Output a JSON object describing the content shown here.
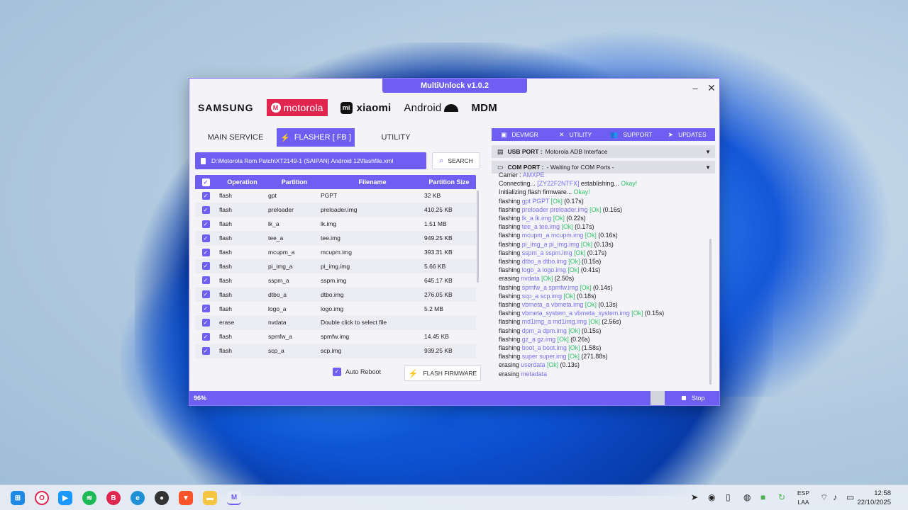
{
  "window": {
    "title": "MultiUnlock v1.0.2",
    "minimize": "–",
    "close": "✕"
  },
  "brands": [
    "SAMSUNG",
    "motorola",
    "xiaomi",
    "Android",
    "MDM"
  ],
  "left_tabs": [
    "MAIN SERVICE",
    "FLASHER [ FB ]",
    "UTILITY"
  ],
  "active_left_tab": "FLASHER [ FB ]",
  "flash_file_path": "D:\\Motorola Rom Patch\\XT2149-1 (SAIPAN) Android 12\\flashfile.xml",
  "search_label": "SEARCH",
  "table": {
    "headers": [
      "Operation",
      "Partition",
      "Filename",
      "Partition Size"
    ],
    "rows": [
      {
        "op": "flash",
        "partition": "gpt",
        "filename": "PGPT",
        "size": "32 KB"
      },
      {
        "op": "flash",
        "partition": "preloader",
        "filename": "preloader.img",
        "size": "410.25 KB"
      },
      {
        "op": "flash",
        "partition": "lk_a",
        "filename": "lk.img",
        "size": "1.51 MB"
      },
      {
        "op": "flash",
        "partition": "tee_a",
        "filename": "tee.img",
        "size": "949.25 KB"
      },
      {
        "op": "flash",
        "partition": "mcupm_a",
        "filename": "mcupm.img",
        "size": "393.31 KB"
      },
      {
        "op": "flash",
        "partition": "pi_img_a",
        "filename": "pi_img.img",
        "size": "5.66 KB"
      },
      {
        "op": "flash",
        "partition": "sspm_a",
        "filename": "sspm.img",
        "size": "645.17 KB"
      },
      {
        "op": "flash",
        "partition": "dtbo_a",
        "filename": "dtbo.img",
        "size": "276.05 KB"
      },
      {
        "op": "flash",
        "partition": "logo_a",
        "filename": "logo.img",
        "size": "5.2 MB"
      },
      {
        "op": "erase",
        "partition": "nvdata",
        "filename": "Double click to select file",
        "size": ""
      },
      {
        "op": "flash",
        "partition": "spmfw_a",
        "filename": "spmfw.img",
        "size": "14.45 KB"
      },
      {
        "op": "flash",
        "partition": "scp_a",
        "filename": "scp.img",
        "size": "939.25 KB"
      }
    ]
  },
  "auto_reboot_label": "Auto Reboot",
  "flash_firmware_label": "FLASH FIRMWARE",
  "right_tabs": [
    "DEVMGR",
    "UTILITY",
    "SUPPORT",
    "UPDATES"
  ],
  "usb_port": {
    "label": "USB PORT :",
    "value": "Motorola ADB Interface"
  },
  "com_port": {
    "label": "COM PORT :",
    "value": "- Waiting for COM Ports -"
  },
  "log": [
    [
      [
        "Carrier : ",
        "n"
      ],
      [
        "AMXPE",
        "p"
      ]
    ],
    [
      [
        "Connecting... ",
        "n"
      ],
      [
        "[ZY22F2NTFX]",
        "p"
      ],
      [
        " establishing... ",
        "n"
      ],
      [
        "Okay!",
        "g"
      ]
    ],
    [
      [
        "Initializing flash firmware... ",
        "n"
      ],
      [
        "Okay!",
        "g"
      ]
    ],
    [
      [
        "flashing ",
        "n"
      ],
      [
        "gpt PGPT",
        "p"
      ],
      [
        " [Ok]",
        "g"
      ],
      [
        " (0.17s)",
        "n"
      ]
    ],
    [
      [
        "flashing ",
        "n"
      ],
      [
        "preloader preloader.img",
        "p"
      ],
      [
        " [Ok]",
        "g"
      ],
      [
        " (0.16s)",
        "n"
      ]
    ],
    [
      [
        "flashing ",
        "n"
      ],
      [
        "lk_a lk.img",
        "p"
      ],
      [
        " [Ok]",
        "g"
      ],
      [
        " (0.22s)",
        "n"
      ]
    ],
    [
      [
        "flashing ",
        "n"
      ],
      [
        "tee_a tee.img",
        "p"
      ],
      [
        " [Ok]",
        "g"
      ],
      [
        " (0.17s)",
        "n"
      ]
    ],
    [
      [
        "flashing ",
        "n"
      ],
      [
        "mcupm_a mcupm.img",
        "p"
      ],
      [
        " [Ok]",
        "g"
      ],
      [
        " (0.16s)",
        "n"
      ]
    ],
    [
      [
        "flashing ",
        "n"
      ],
      [
        "pi_img_a pi_img.img",
        "p"
      ],
      [
        " [Ok]",
        "g"
      ],
      [
        " (0.13s)",
        "n"
      ]
    ],
    [
      [
        "flashing ",
        "n"
      ],
      [
        "sspm_a sspm.img",
        "p"
      ],
      [
        " [Ok]",
        "g"
      ],
      [
        " (0.17s)",
        "n"
      ]
    ],
    [
      [
        "flashing ",
        "n"
      ],
      [
        "dtbo_a dtbo.img",
        "p"
      ],
      [
        " [Ok]",
        "g"
      ],
      [
        " (0.15s)",
        "n"
      ]
    ],
    [
      [
        "flashing ",
        "n"
      ],
      [
        "logo_a logo.img",
        "p"
      ],
      [
        " [Ok]",
        "g"
      ],
      [
        " (0.41s)",
        "n"
      ]
    ],
    [
      [
        "erasing ",
        "n"
      ],
      [
        "nvdata",
        "p"
      ],
      [
        " [Ok]",
        "g"
      ],
      [
        " (2.50s)",
        "n"
      ]
    ],
    [
      [
        "flashing ",
        "n"
      ],
      [
        "spmfw_a spmfw.img",
        "p"
      ],
      [
        " [Ok]",
        "g"
      ],
      [
        " (0.14s)",
        "n"
      ]
    ],
    [
      [
        "flashing ",
        "n"
      ],
      [
        "scp_a scp.img",
        "p"
      ],
      [
        " [Ok]",
        "g"
      ],
      [
        " (0.18s)",
        "n"
      ]
    ],
    [
      [
        "flashing ",
        "n"
      ],
      [
        "vbmeta_a vbmeta.img",
        "p"
      ],
      [
        " [Ok]",
        "g"
      ],
      [
        " (0.13s)",
        "n"
      ]
    ],
    [
      [
        "flashing ",
        "n"
      ],
      [
        "vbmeta_system_a vbmeta_system.img",
        "p"
      ],
      [
        " [Ok]",
        "g"
      ],
      [
        " (0.15s)",
        "n"
      ]
    ],
    [
      [
        "flashing ",
        "n"
      ],
      [
        "md1img_a md1img.img",
        "p"
      ],
      [
        " [Ok]",
        "g"
      ],
      [
        " (2.56s)",
        "n"
      ]
    ],
    [
      [
        "flashing ",
        "n"
      ],
      [
        "dpm_a dpm.img",
        "p"
      ],
      [
        " [Ok]",
        "g"
      ],
      [
        " (0.15s)",
        "n"
      ]
    ],
    [
      [
        "flashing ",
        "n"
      ],
      [
        "gz_a gz.img",
        "p"
      ],
      [
        " [Ok]",
        "g"
      ],
      [
        " (0.26s)",
        "n"
      ]
    ],
    [
      [
        "flashing ",
        "n"
      ],
      [
        "boot_a boot.img",
        "p"
      ],
      [
        " [Ok]",
        "g"
      ],
      [
        " (1.58s)",
        "n"
      ]
    ],
    [
      [
        "flashing ",
        "n"
      ],
      [
        "super super.img",
        "p"
      ],
      [
        " [Ok]",
        "g"
      ],
      [
        " (271.88s)",
        "n"
      ]
    ],
    [
      [
        "erasing ",
        "n"
      ],
      [
        "userdata",
        "p"
      ],
      [
        " [Ok]",
        "g"
      ],
      [
        " (0.13s)",
        "n"
      ]
    ],
    [
      [
        "erasing ",
        "n"
      ],
      [
        "metadata",
        "p"
      ]
    ]
  ],
  "progress": {
    "label": "96%",
    "value": 0.96
  },
  "stop_label": "Stop",
  "colors": {
    "accent": "#6f5ef2",
    "motorola": "#e0254e",
    "log_purple": "#7a6ff0",
    "log_green": "#35c46a"
  },
  "taskbar": {
    "icons": [
      "windows-start-icon",
      "opera-icon",
      "prime-video-icon",
      "spotify-icon",
      "app-red-icon",
      "edge-icon",
      "obs-icon",
      "brave-icon",
      "file-explorer-icon",
      "multiunlock-icon"
    ],
    "language_top": "ESP",
    "language_bottom": "LAA",
    "time": "12:58",
    "date": "22/10/2025"
  }
}
